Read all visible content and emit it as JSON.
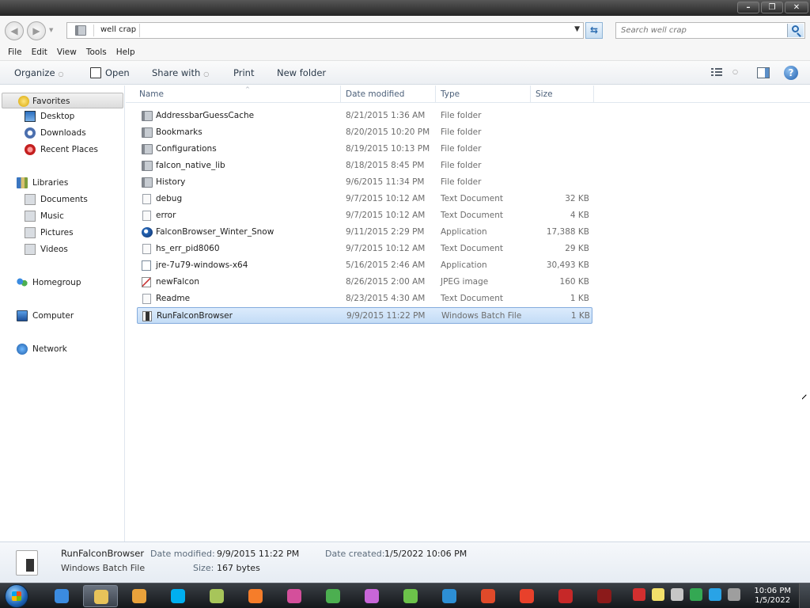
{
  "window": {
    "minimize_label": "–",
    "maximize_label": "❐",
    "close_label": "✕"
  },
  "address": {
    "back_glyph": "◀",
    "forward_glyph": "▶",
    "crumb": "well crap",
    "dropdown_glyph": "▼",
    "refresh_glyph": "⇆",
    "search_placeholder": "Search well crap"
  },
  "menu": {
    "items": [
      "File",
      "Edit",
      "View",
      "Tools",
      "Help"
    ]
  },
  "toolbar": {
    "organize": "Organize",
    "open": "Open",
    "share_with": "Share with",
    "print": "Print",
    "new_folder": "New folder",
    "dropdown_glyph": "○",
    "help_glyph": "?"
  },
  "nav": {
    "favorites": "Favorites",
    "desktop": "Desktop",
    "downloads": "Downloads",
    "recent_places": "Recent Places",
    "libraries": "Libraries",
    "documents": "Documents",
    "music": "Music",
    "pictures": "Pictures",
    "videos": "Videos",
    "homegroup": "Homegroup",
    "computer": "Computer",
    "network": "Network"
  },
  "columns": {
    "name": "Name",
    "date": "Date modified",
    "type": "Type",
    "size": "Size",
    "sort_glyph": "^"
  },
  "files": [
    {
      "name": "AddressbarGuessCache",
      "date": "8/21/2015 1:36 AM",
      "type": "File folder",
      "size": "",
      "icon": "folder-icon"
    },
    {
      "name": "Bookmarks",
      "date": "8/20/2015 10:20 PM",
      "type": "File folder",
      "size": "",
      "icon": "folder-icon"
    },
    {
      "name": "Configurations",
      "date": "8/19/2015 10:13 PM",
      "type": "File folder",
      "size": "",
      "icon": "folder-icon"
    },
    {
      "name": "falcon_native_lib",
      "date": "8/18/2015 8:45 PM",
      "type": "File folder",
      "size": "",
      "icon": "folder-icon"
    },
    {
      "name": "History",
      "date": "9/6/2015 11:34 PM",
      "type": "File folder",
      "size": "",
      "icon": "folder-icon"
    },
    {
      "name": "debug",
      "date": "9/7/2015 10:12 AM",
      "type": "Text Document",
      "size": "32 KB",
      "icon": "text-file-icon"
    },
    {
      "name": "error",
      "date": "9/7/2015 10:12 AM",
      "type": "Text Document",
      "size": "4 KB",
      "icon": "text-file-icon"
    },
    {
      "name": "FalconBrowser_Winter_Snow",
      "date": "9/11/2015 2:29 PM",
      "type": "Application",
      "size": "17,388 KB",
      "icon": "falcon-app-icon"
    },
    {
      "name": "hs_err_pid8060",
      "date": "9/7/2015 10:12 AM",
      "type": "Text Document",
      "size": "29 KB",
      "icon": "text-file-icon"
    },
    {
      "name": "jre-7u79-windows-x64",
      "date": "5/16/2015 2:46 AM",
      "type": "Application",
      "size": "30,493 KB",
      "icon": "java-installer-icon"
    },
    {
      "name": "newFalcon",
      "date": "8/26/2015 2:00 AM",
      "type": "JPEG image",
      "size": "160 KB",
      "icon": "jpeg-image-icon"
    },
    {
      "name": "Readme",
      "date": "8/23/2015 4:30 AM",
      "type": "Text Document",
      "size": "1 KB",
      "icon": "text-file-icon"
    },
    {
      "name": "RunFalconBrowser",
      "date": "9/9/2015 11:22 PM",
      "type": "Windows Batch File",
      "size": "1 KB",
      "icon": "batch-file-icon",
      "selected": true
    }
  ],
  "details": {
    "filename": "RunFalconBrowser",
    "filetype": "Windows Batch File",
    "modified_label": "Date modified:",
    "modified_value": "9/9/2015 11:22 PM",
    "created_label": "Date created:",
    "created_value": "1/5/2022 10:06 PM",
    "size_label": "Size:",
    "size_value": "167 bytes"
  },
  "taskbar": {
    "time": "10:06 PM",
    "date": "1/5/2022",
    "apps": [
      {
        "name": "internet-explorer-icon",
        "color": "#3b8be0"
      },
      {
        "name": "windows-explorer-icon",
        "color": "#e8c35a",
        "active": true
      },
      {
        "name": "media-player-icon",
        "color": "#e9a23b"
      },
      {
        "name": "skype-icon",
        "color": "#00aff0"
      },
      {
        "name": "paint-icon",
        "color": "#a7c55a"
      },
      {
        "name": "firefox-pinned-icon",
        "color": "#f57d2a"
      },
      {
        "name": "color-wheel-app-icon",
        "color": "#d44f9b"
      },
      {
        "name": "chrome-icon",
        "color": "#4caf50"
      },
      {
        "name": "picasa-icon",
        "color": "#c866d8"
      },
      {
        "name": "green-app-icon",
        "color": "#6cc24a"
      },
      {
        "name": "virtualbox-icon",
        "color": "#2d8fd5"
      },
      {
        "name": "acrobat-icon",
        "color": "#e04a2a"
      },
      {
        "name": "download-manager-icon",
        "color": "#e8412b"
      },
      {
        "name": "red-browser-icon",
        "color": "#c62828"
      },
      {
        "name": "kenya-flag-icon",
        "color": "#8b1a1a"
      }
    ],
    "tray": [
      {
        "name": "acrobat-tray-icon",
        "color": "#d32f2f"
      },
      {
        "name": "notes-tray-icon",
        "color": "#f3e06a"
      },
      {
        "name": "check-tray-icon",
        "color": "#c6c6c6"
      },
      {
        "name": "flag-tray-icon",
        "color": "#34a853"
      },
      {
        "name": "monitor-tray-icon",
        "color": "#29a3e6"
      },
      {
        "name": "volume-tray-icon",
        "color": "#9e9e9e"
      }
    ]
  }
}
